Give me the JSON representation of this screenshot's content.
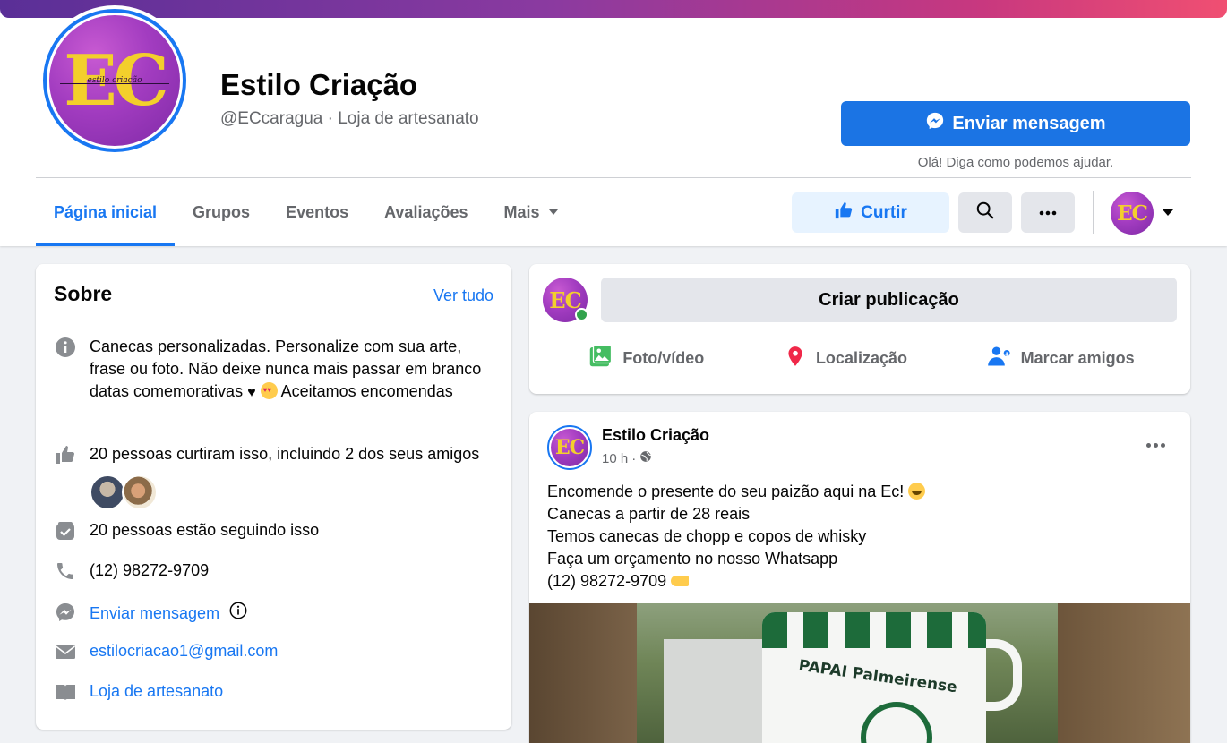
{
  "header": {
    "page_name": "Estilo Criação",
    "page_subtitle": "@ECcaragua · Loja de artesanato",
    "logo_text": "EC",
    "logo_script": "estilo criação",
    "message_button": "Enviar mensagem",
    "message_hint": "Olá! Diga como podemos ajudar."
  },
  "tabs": [
    {
      "label": "Página inicial",
      "active": true
    },
    {
      "label": "Grupos"
    },
    {
      "label": "Eventos"
    },
    {
      "label": "Avaliações"
    },
    {
      "label": "Mais"
    }
  ],
  "actions": {
    "like_label": "Curtir",
    "search_icon": "search-icon",
    "more_icon": "more-horizontal-icon"
  },
  "about": {
    "title": "Sobre",
    "see_all": "Ver tudo",
    "description_1": "Canecas personalizadas. Personalize com sua arte, frase ou foto. Não deixe nunca mais passar em branco datas comemorativas",
    "description_2": "Aceitamos encomendas",
    "likes": "20 pessoas curtiram isso, incluindo 2 dos seus amigos",
    "followers": "20 pessoas estão seguindo isso",
    "phone": "(12) 98272-9709",
    "send_message": "Enviar mensagem",
    "email": "estilocriacao1@gmail.com",
    "category": "Loja de artesanato"
  },
  "composer": {
    "create_post": "Criar publicação",
    "photo_video": "Foto/vídeo",
    "location": "Localização",
    "tag_friends": "Marcar amigos"
  },
  "post": {
    "author": "Estilo Criação",
    "time": "10 h",
    "separator": "·",
    "line_1": "Encomende o presente do seu paizão aqui na Ec!",
    "line_2": "Canecas a partir de 28 reais",
    "line_3": "Temos canecas de chopp e copos de whisky",
    "line_4": "Faça um orçamento no nosso Whatsapp",
    "line_5": "(12) 98272-9709",
    "image_caption": "PAPAI Palmeirense"
  },
  "colors": {
    "accent": "#1877f2",
    "brand_purple": "#a23cc0",
    "brand_yellow": "#f3cf2c",
    "online": "#31a24c"
  }
}
